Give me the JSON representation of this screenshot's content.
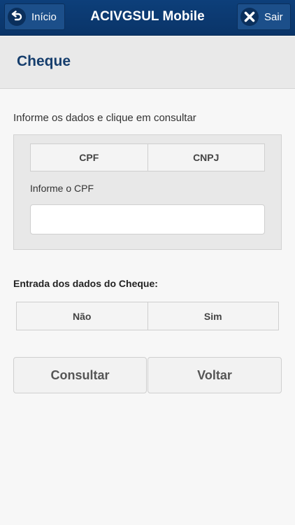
{
  "header": {
    "home_label": "Início",
    "title": "ACIVGSUL Mobile",
    "exit_label": "Sair"
  },
  "page": {
    "title": "Cheque",
    "instructions": "Informe os dados e clique em consultar"
  },
  "document_type": {
    "options": [
      "CPF",
      "CNPJ"
    ]
  },
  "cpf_field": {
    "label": "Informe o CPF",
    "value": "",
    "placeholder": ""
  },
  "cheque_entry": {
    "label": "Entrada dos dados do Cheque:",
    "options": [
      "Não",
      "Sim"
    ]
  },
  "actions": {
    "consult_label": "Consultar",
    "back_label": "Voltar"
  },
  "colors": {
    "header_bg": "#0d3f7a",
    "title_color": "#163e6d",
    "page_bg": "#f7f7f7"
  },
  "icons": {
    "home": "undo-arrow-icon",
    "exit": "close-icon"
  }
}
